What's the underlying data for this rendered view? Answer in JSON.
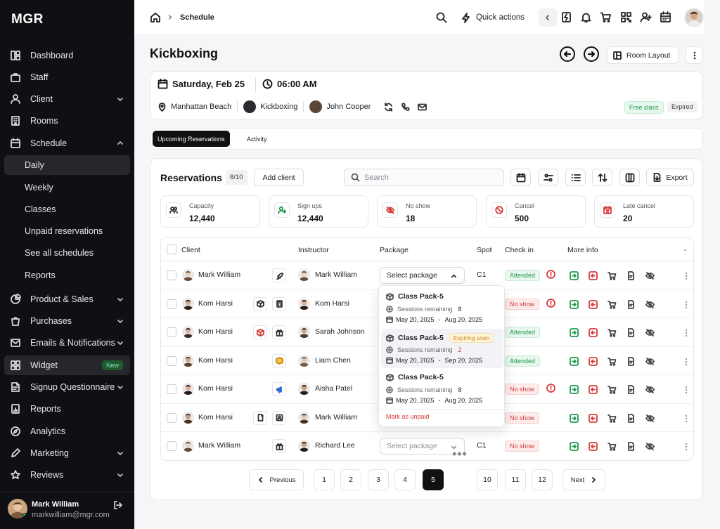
{
  "app": {
    "logo": "MGR"
  },
  "sidebar": {
    "items": [
      {
        "label": "Dashboard"
      },
      {
        "label": "Staff"
      },
      {
        "label": "Client"
      },
      {
        "label": "Rooms"
      },
      {
        "label": "Schedule"
      },
      {
        "label": "Daily"
      },
      {
        "label": "Weekly"
      },
      {
        "label": "Classes"
      },
      {
        "label": "Unpaid reservations"
      },
      {
        "label": "See all schedules"
      },
      {
        "label": "Reports"
      },
      {
        "label": "Product & Sales"
      },
      {
        "label": "Purchases"
      },
      {
        "label": "Emails & Notifications"
      },
      {
        "label": "Widget",
        "badge": "New"
      },
      {
        "label": "Signup Questionnaire"
      },
      {
        "label": "Reports"
      },
      {
        "label": "Analytics"
      },
      {
        "label": "Marketing"
      },
      {
        "label": "Reviews"
      }
    ],
    "user": {
      "name": "Mark William",
      "email": "markwilliam@mgr.com"
    }
  },
  "topbar": {
    "breadcrumb": "Schedule",
    "quick_actions": "Quick actions"
  },
  "page": {
    "title": "Kickboxing",
    "room_layout": "Room Layout"
  },
  "info": {
    "date": "Saturday, Feb 25",
    "time": "06:00 AM",
    "location": "Manhattan Beach",
    "class": "Kickboxing",
    "instructor": "John Cooper",
    "tag_free": "Free class",
    "tag_expired": "Expired"
  },
  "tabs": [
    {
      "label": "Upcoming Reservations"
    },
    {
      "label": "Activity"
    }
  ],
  "reservations": {
    "title": "Reservations",
    "count": "8/10",
    "add_client": "Add client",
    "search_placeholder": "Search",
    "export": "Export",
    "stats": [
      {
        "label": "Capacity",
        "value": "12,440"
      },
      {
        "label": "Sign ups",
        "value": "12,440"
      },
      {
        "label": "No show",
        "value": "18"
      },
      {
        "label": "Cancel",
        "value": "500"
      },
      {
        "label": "Late cancel",
        "value": "20"
      }
    ],
    "columns": {
      "client": "Client",
      "instructor": "Instructor",
      "package": "Package",
      "spot": "Spot",
      "checkin": "Check in",
      "more": "More info",
      "dash": "-"
    },
    "rows": [
      {
        "client": "Mark William",
        "instructor": "Mark William",
        "package": "Select package",
        "spot": "C1",
        "status": "Attended"
      },
      {
        "client": "Kom Harsi",
        "instructor": "Kom Harsi",
        "package": "",
        "spot": "",
        "status": "No show"
      },
      {
        "client": "Kom Harsi",
        "instructor": "Sarah Johnson",
        "package": "",
        "spot": "",
        "status": "Attended"
      },
      {
        "client": "Kom Harsi",
        "instructor": "Liam Chen",
        "package": "",
        "spot": "",
        "status": "Attended"
      },
      {
        "client": "Kom Harsi",
        "instructor": "Aisha Patel",
        "package": "",
        "spot": "",
        "status": "No show"
      },
      {
        "client": "Kom Harsi",
        "instructor": "Mark William",
        "package": "",
        "spot": "",
        "status": "No show"
      },
      {
        "client": "Mark William",
        "instructor": "Richard Lee",
        "package": "Select package",
        "spot": "C1",
        "status": "No show"
      }
    ],
    "dropdown": {
      "items": [
        {
          "name": "Class Pack-5",
          "remaining_label": "Sessions remaining",
          "remaining": "8",
          "start": "May 20, 2025",
          "end": "Aug 20, 2025"
        },
        {
          "name": "Class Pack-5",
          "tag": "Expiring soon",
          "remaining_label": "Sessions remaining",
          "remaining": "2",
          "start": "May 20, 2025",
          "end": "Sep 20, 2025"
        },
        {
          "name": "Class Pack-5",
          "remaining_label": "Sessions remaining",
          "remaining": "8",
          "start": "May 20, 2025",
          "end": "Aug 20, 2025"
        }
      ],
      "date_sep": "-",
      "mark_unpaid": "Mark as unpaid"
    }
  },
  "pagination": {
    "previous": "Previous",
    "next": "Next",
    "pages": [
      "1",
      "2",
      "3",
      "4",
      "5",
      "10",
      "11",
      "12"
    ],
    "current": "5"
  },
  "colors": {
    "accent": "#111111",
    "success": "#1f9a4c",
    "danger": "#d63b3b",
    "warning": "#c98a12"
  }
}
